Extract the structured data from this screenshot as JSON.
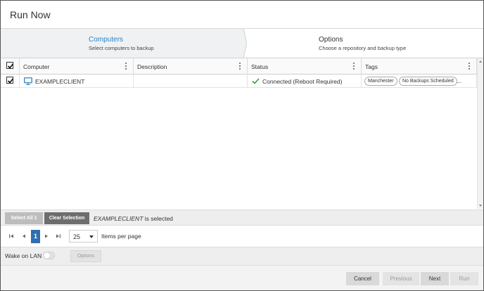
{
  "dialog": {
    "title": "Run Now"
  },
  "steps": [
    {
      "title": "Computers",
      "subtitle": "Select computers to backup"
    },
    {
      "title": "Options",
      "subtitle": "Choose a repository and backup type"
    }
  ],
  "grid": {
    "header_checked": true,
    "columns": [
      {
        "label": "Computer"
      },
      {
        "label": "Description"
      },
      {
        "label": "Status"
      },
      {
        "label": "Tags"
      }
    ],
    "rows": [
      {
        "checked": true,
        "computer": "EXAMPLECLIENT",
        "description": "",
        "status": "Connected (Reboot Required)",
        "tags": [
          "Manchester",
          "No Backups Scheduled"
        ],
        "tags_more": "..."
      }
    ]
  },
  "selection": {
    "select_all_label": "Select All 1",
    "clear_label": "Clear Selection",
    "selected_name": "EXAMPLECLIENT",
    "selected_suffix": " is selected"
  },
  "pager": {
    "current_page": "1",
    "page_size": "25",
    "items_per_page_label": "Items per page"
  },
  "wake_on_lan": {
    "label": "Wake on LAN",
    "enabled": false,
    "options_label": "Options"
  },
  "footer": {
    "cancel": "Cancel",
    "previous": "Previous",
    "next": "Next",
    "run": "Run"
  },
  "colors": {
    "accent": "#2a83c4",
    "page_active": "#2e6fb0",
    "status_ok": "#3a9d3a"
  }
}
